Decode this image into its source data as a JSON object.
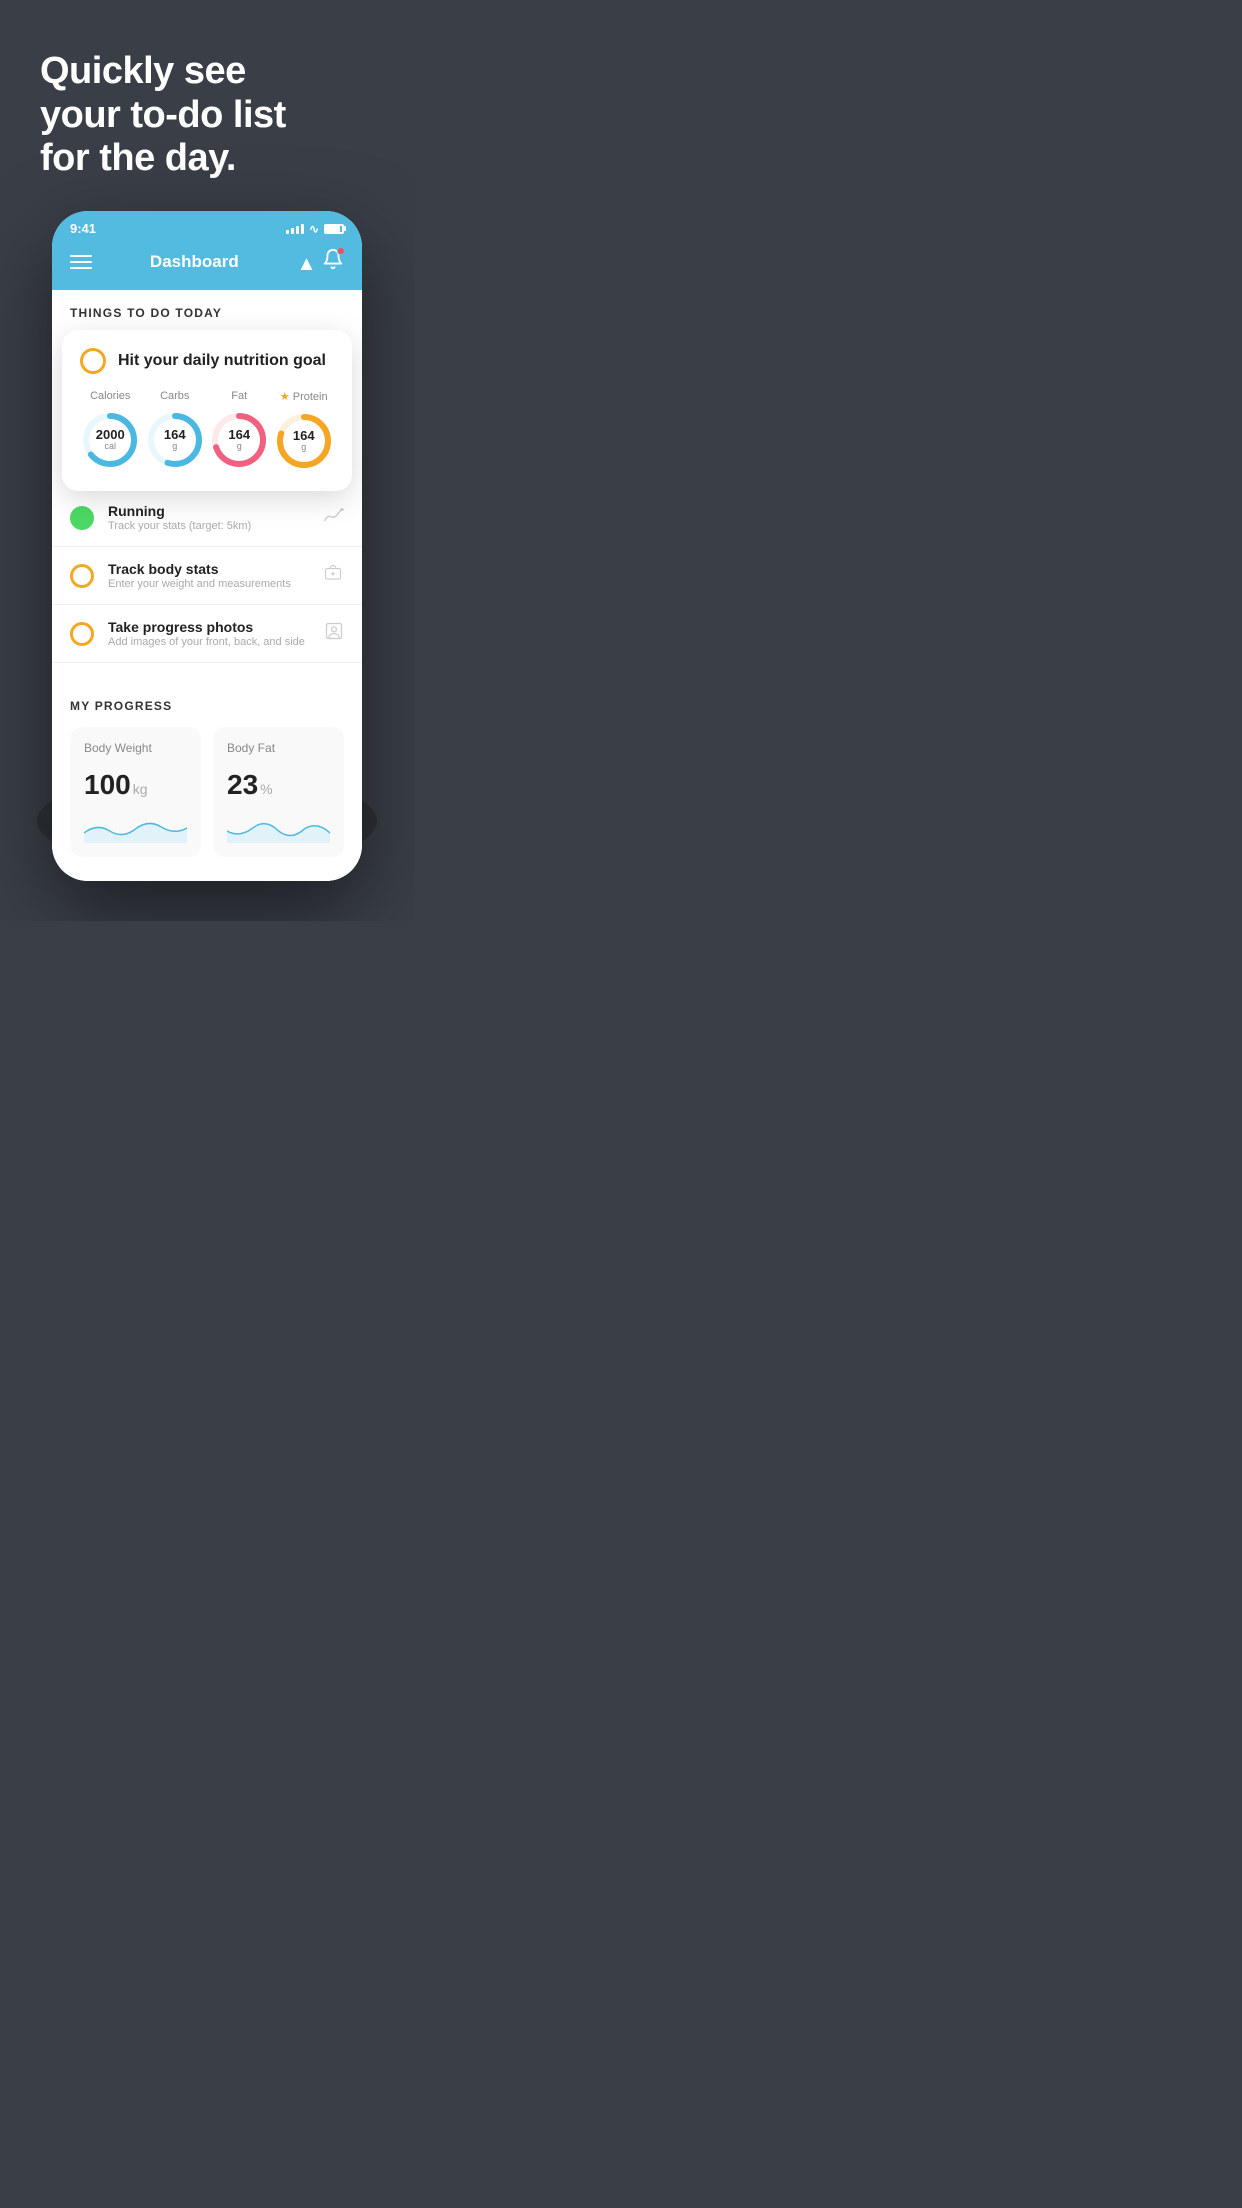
{
  "hero": {
    "line1": "Quickly see",
    "line2": "your to-do list",
    "line3": "for the day."
  },
  "status_bar": {
    "time": "9:41"
  },
  "nav": {
    "title": "Dashboard"
  },
  "things_section": {
    "header": "THINGS TO DO TODAY"
  },
  "nutrition_card": {
    "title": "Hit your daily nutrition goal",
    "cols": [
      {
        "label": "Calories",
        "value": "2000",
        "unit": "cal",
        "color": "#4ab8e0",
        "percent": 65,
        "star": false
      },
      {
        "label": "Carbs",
        "value": "164",
        "unit": "g",
        "color": "#4ab8e0",
        "percent": 55,
        "star": false
      },
      {
        "label": "Fat",
        "value": "164",
        "unit": "g",
        "color": "#f06080",
        "percent": 70,
        "star": false
      },
      {
        "label": "Protein",
        "value": "164",
        "unit": "g",
        "color": "#f5a623",
        "percent": 80,
        "star": true
      }
    ]
  },
  "todo_items": [
    {
      "title": "Running",
      "subtitle": "Track your stats (target: 5km)",
      "circle": "green",
      "icon": "shoe"
    },
    {
      "title": "Track body stats",
      "subtitle": "Enter your weight and measurements",
      "circle": "yellow",
      "icon": "scale"
    },
    {
      "title": "Take progress photos",
      "subtitle": "Add images of your front, back, and side",
      "circle": "yellow",
      "icon": "person"
    }
  ],
  "progress": {
    "header": "MY PROGRESS",
    "cards": [
      {
        "label": "Body Weight",
        "value": "100",
        "unit": "kg"
      },
      {
        "label": "Body Fat",
        "value": "23",
        "unit": "%"
      }
    ]
  }
}
